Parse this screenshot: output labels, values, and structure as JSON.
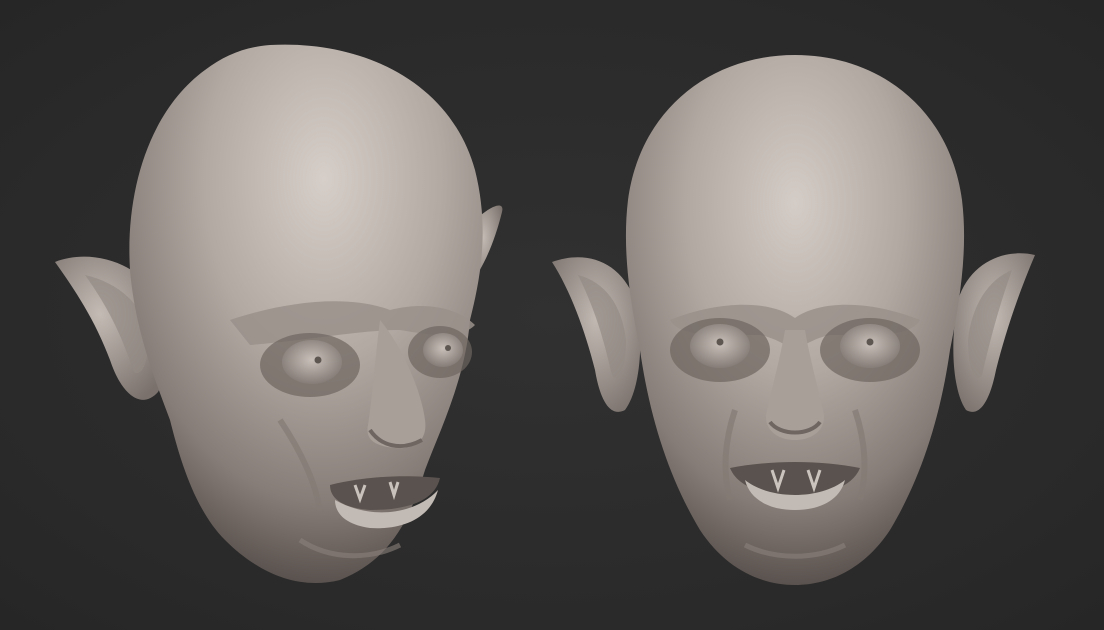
{
  "scene": {
    "background_color": "#2b2b2b",
    "material_color": "#b5aca6",
    "objects": [
      {
        "name": "vampire-head-three-quarter-view",
        "view": "three-quarter"
      },
      {
        "name": "vampire-head-front-view",
        "view": "front"
      }
    ]
  }
}
